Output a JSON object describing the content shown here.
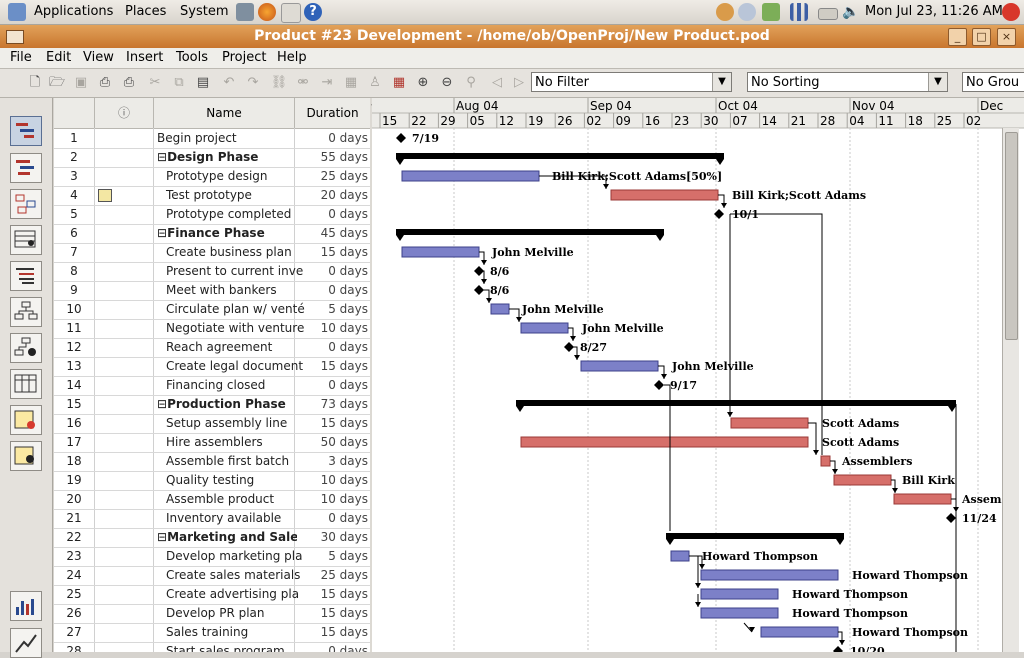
{
  "panel": {
    "menus": [
      "Applications",
      "Places",
      "System"
    ],
    "clock": "Mon Jul 23, 11:26 AM"
  },
  "window": {
    "title": "Product #23 Development - /home/ob/OpenProj/New Product.pod"
  },
  "menubar": [
    "File",
    "Edit",
    "View",
    "Insert",
    "Tools",
    "Project",
    "Help"
  ],
  "toolbar": {
    "filter": "No Filter",
    "sorting": "No Sorting",
    "grouping": "No Grou"
  },
  "table": {
    "headers": {
      "info": "ⓘ",
      "name": "Name",
      "duration": "Duration"
    },
    "rows": [
      {
        "id": "1",
        "name": "Begin project",
        "duration": "0 days",
        "summary": false,
        "indent": 0
      },
      {
        "id": "2",
        "name": "Design Phase",
        "duration": "55 days",
        "summary": true,
        "indent": 0
      },
      {
        "id": "3",
        "name": "Prototype design",
        "duration": "25 days",
        "summary": false,
        "indent": 1
      },
      {
        "id": "4",
        "name": "Test prototype",
        "duration": "20 days",
        "summary": false,
        "indent": 1
      },
      {
        "id": "5",
        "name": "Prototype completed",
        "duration": "0 days",
        "summary": false,
        "indent": 1
      },
      {
        "id": "6",
        "name": "Finance Phase",
        "duration": "45 days",
        "summary": true,
        "indent": 0
      },
      {
        "id": "7",
        "name": "Create business plan",
        "duration": "15 days",
        "summary": false,
        "indent": 1
      },
      {
        "id": "8",
        "name": "Present to current inve",
        "duration": "0 days",
        "summary": false,
        "indent": 1
      },
      {
        "id": "9",
        "name": "Meet with bankers",
        "duration": "0 days",
        "summary": false,
        "indent": 1
      },
      {
        "id": "10",
        "name": "Circulate plan w/ venté",
        "duration": "5 days",
        "summary": false,
        "indent": 1
      },
      {
        "id": "11",
        "name": "Negotiate with venture",
        "duration": "10 days",
        "summary": false,
        "indent": 1
      },
      {
        "id": "12",
        "name": "Reach agreement",
        "duration": "0 days",
        "summary": false,
        "indent": 1
      },
      {
        "id": "13",
        "name": "Create legal document",
        "duration": "15 days",
        "summary": false,
        "indent": 1
      },
      {
        "id": "14",
        "name": "Financing closed",
        "duration": "0 days",
        "summary": false,
        "indent": 1
      },
      {
        "id": "15",
        "name": "Production Phase",
        "duration": "73 days",
        "summary": true,
        "indent": 0
      },
      {
        "id": "16",
        "name": "Setup assembly line",
        "duration": "15 days",
        "summary": false,
        "indent": 1
      },
      {
        "id": "17",
        "name": "Hire assemblers",
        "duration": "50 days",
        "summary": false,
        "indent": 1
      },
      {
        "id": "18",
        "name": "Assemble first batch",
        "duration": "3 days",
        "summary": false,
        "indent": 1
      },
      {
        "id": "19",
        "name": "Quality testing",
        "duration": "10 days",
        "summary": false,
        "indent": 1
      },
      {
        "id": "20",
        "name": "Assemble product",
        "duration": "10 days",
        "summary": false,
        "indent": 1
      },
      {
        "id": "21",
        "name": "Inventory available",
        "duration": "0 days",
        "summary": false,
        "indent": 1
      },
      {
        "id": "22",
        "name": "Marketing and Sales P",
        "duration": "30 days",
        "summary": true,
        "indent": 0
      },
      {
        "id": "23",
        "name": "Develop marketing pla",
        "duration": "5 days",
        "summary": false,
        "indent": 1
      },
      {
        "id": "24",
        "name": "Create sales materials",
        "duration": "25 days",
        "summary": false,
        "indent": 1
      },
      {
        "id": "25",
        "name": "Create advertising pla",
        "duration": "15 days",
        "summary": false,
        "indent": 1
      },
      {
        "id": "26",
        "name": "Develop PR plan",
        "duration": "15 days",
        "summary": false,
        "indent": 1
      },
      {
        "id": "27",
        "name": "Sales training",
        "duration": "15 days",
        "summary": false,
        "indent": 1
      },
      {
        "id": "28",
        "name": "Start sales program",
        "duration": "0 days",
        "summary": false,
        "indent": 1
      }
    ]
  },
  "timescale": {
    "months": [
      "Aug 04",
      "Sep 04",
      "Oct 04",
      "Nov 04",
      "Dec"
    ],
    "days": [
      "15",
      "22",
      "29",
      "05",
      "12",
      "19",
      "26",
      "02",
      "09",
      "16",
      "23",
      "30",
      "07",
      "14",
      "21",
      "28",
      "04",
      "11",
      "18",
      "25",
      "02"
    ]
  },
  "gantt_labels": {
    "m1": "7/19",
    "l3": "Bill Kirk;Scott Adams[50%]",
    "l4": "Bill Kirk;Scott Adams",
    "m5": "10/1",
    "l7": "John Melville",
    "m8": "8/6",
    "m9": "8/6",
    "l10": "John Melville",
    "l11": "John Melville",
    "m12": "8/27",
    "l13": "John Melville",
    "m14": "9/17",
    "l16": "Scott Adams",
    "l17": "Scott Adams",
    "l18": "Assemblers",
    "l19": "Bill Kirk",
    "l20": "Assem",
    "m21": "11/24",
    "l23": "Howard Thompson",
    "l24": "Howard Thompson",
    "l25": "Howard Thompson",
    "l26": "Howard Thompson",
    "l27": "Howard Thompson",
    "m28": "10/20"
  }
}
